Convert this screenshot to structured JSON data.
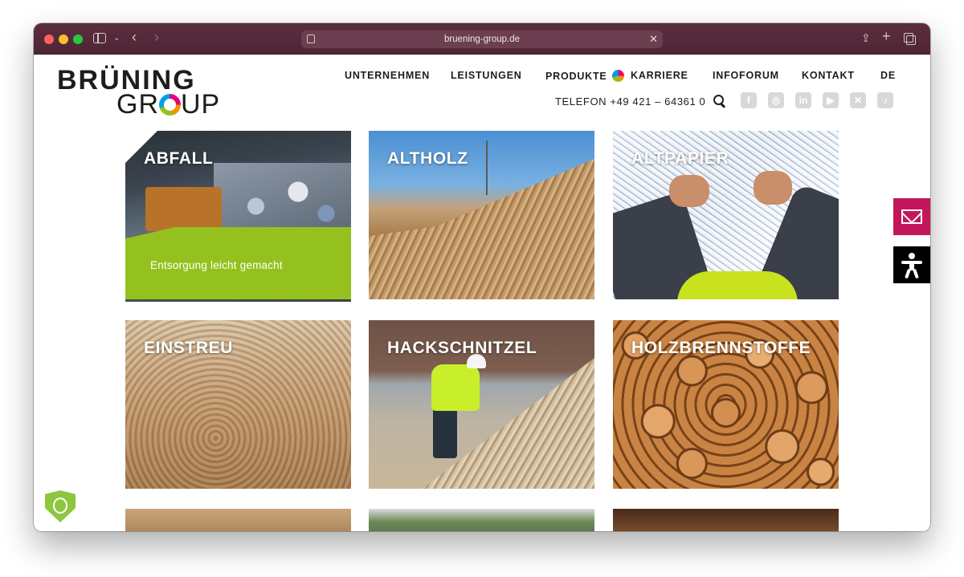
{
  "browser": {
    "url": "bruening-group.de"
  },
  "logo": {
    "line1": "BRÜNING",
    "line2_a": "GR",
    "line2_b": "UP"
  },
  "nav": {
    "items": [
      "UNTERNEHMEN",
      "LEISTUNGEN",
      "PRODUKTE",
      "KARRIERE",
      "INFOFORUM",
      "KONTAKT",
      "DE"
    ]
  },
  "header": {
    "phone": "TELEFON +49 421 – 64361 0",
    "social": [
      "f",
      "◎",
      "in",
      "▶",
      "✕",
      "♪"
    ]
  },
  "tiles": [
    {
      "title": "ABFALL",
      "subtitle": "Entsorgung leicht gemacht"
    },
    {
      "title": "ALTHOLZ"
    },
    {
      "title": "ALTPAPIER"
    },
    {
      "title": "EINSTREU"
    },
    {
      "title": "HACKSCHNITZEL"
    },
    {
      "title": "HOLZBRENNSTOFFE"
    }
  ],
  "colors": {
    "accent_green": "#95c11f",
    "mail_button": "#c2185b",
    "titlebar": "#4f2636"
  }
}
